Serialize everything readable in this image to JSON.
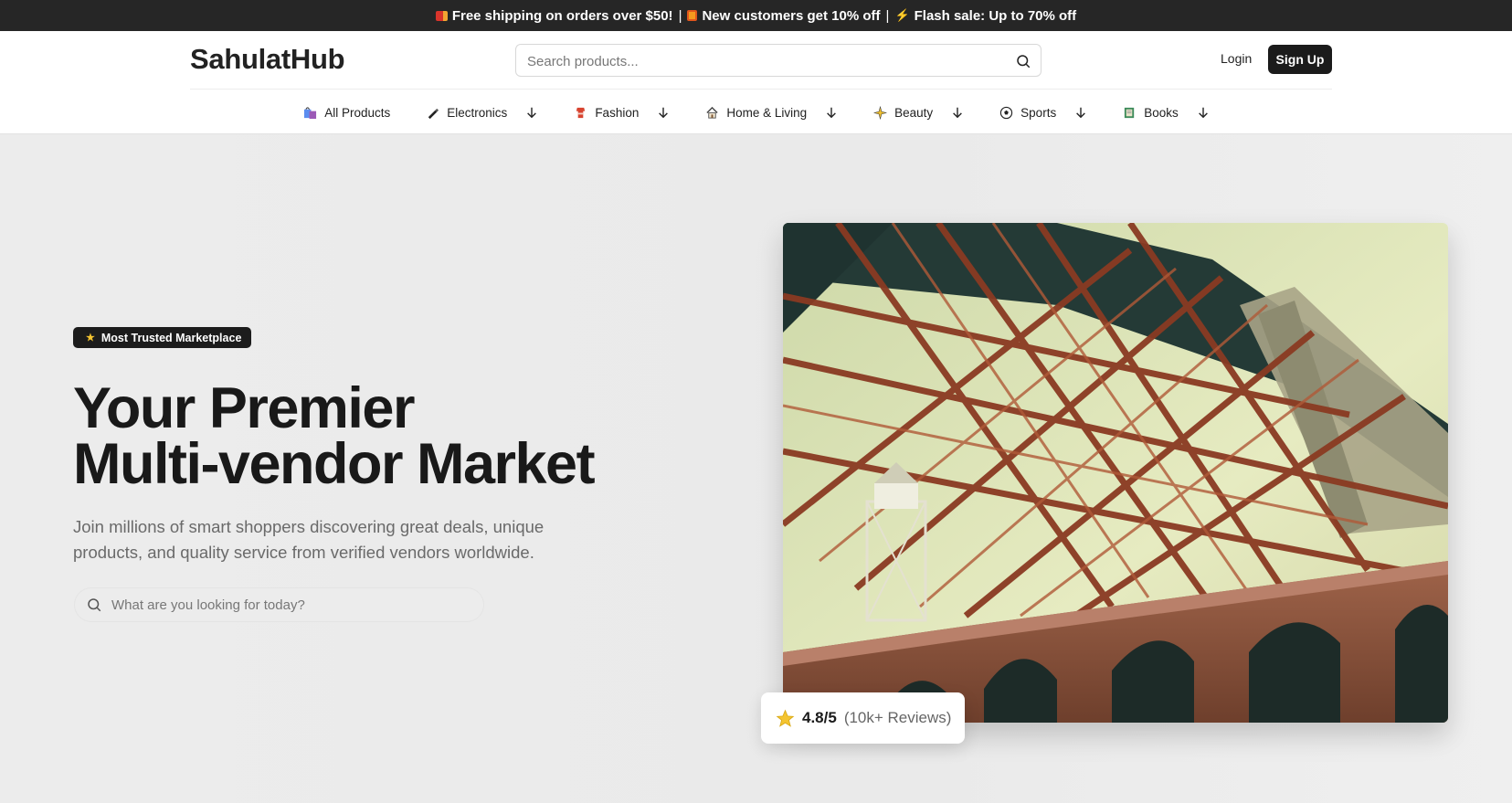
{
  "announcement": {
    "messages": [
      {
        "icon": "truck-icon",
        "text": "Free shipping on orders over $50!"
      },
      {
        "icon": "gift-icon",
        "text": "New customers get 10% off"
      },
      {
        "icon": "lightning-icon",
        "text": "Flash sale: Up to 70% off"
      }
    ],
    "separator": "|"
  },
  "header": {
    "logo": "SahulatHub",
    "search_placeholder": "Search products...",
    "login_label": "Login",
    "signup_label": "Sign Up"
  },
  "nav": {
    "items": [
      {
        "icon": "shopping-bags-icon",
        "label": "All Products"
      },
      {
        "icon": "pen-icon",
        "label": "Electronics"
      },
      {
        "icon": "shirt-icon",
        "label": "Fashion"
      },
      {
        "icon": "house-icon",
        "label": "Home & Living"
      },
      {
        "icon": "sparkle-icon",
        "label": "Beauty"
      },
      {
        "icon": "soccer-ball-icon",
        "label": "Sports"
      },
      {
        "icon": "book-icon",
        "label": "Books"
      }
    ]
  },
  "hero": {
    "badge_icon": "star-icon",
    "badge": "Most Trusted Marketplace",
    "headline_line1": "Your Premier",
    "headline_line2": "Multi-vendor Market",
    "subtitle": "Join millions of smart shoppers discovering great deals, unique products, and quality service from verified vendors worldwide.",
    "search_placeholder": "What are you looking for today?",
    "image_subject": "bridge-steel-truss-photo",
    "rating": {
      "icon": "star-icon",
      "score": "4.8/5",
      "reviews": "(10k+ Reviews)"
    }
  },
  "colors": {
    "announcement_bg": "#262626",
    "primary_button": "#1b1b1b",
    "hero_bg": "#ebebeb",
    "star": "#f4c430"
  }
}
